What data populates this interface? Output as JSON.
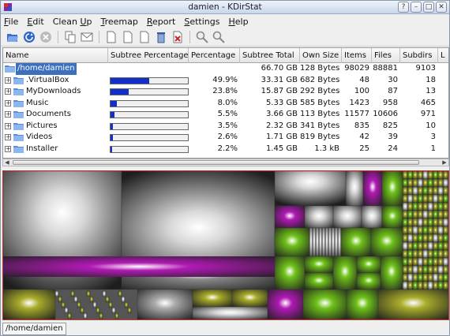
{
  "window": {
    "title": "damien - KDirStat"
  },
  "menu": [
    {
      "id": "file",
      "pre": "",
      "u": "F",
      "post": "ile"
    },
    {
      "id": "edit",
      "pre": "",
      "u": "E",
      "post": "dit"
    },
    {
      "id": "cleanup",
      "pre": "Clean ",
      "u": "U",
      "post": "p"
    },
    {
      "id": "treemap",
      "pre": "",
      "u": "T",
      "post": "reemap"
    },
    {
      "id": "report",
      "pre": "",
      "u": "R",
      "post": "eport"
    },
    {
      "id": "settings",
      "pre": "",
      "u": "S",
      "post": "ettings"
    },
    {
      "id": "help",
      "pre": "",
      "u": "H",
      "post": "elp"
    }
  ],
  "toolbar": [
    "open-folder-icon",
    "refresh-icon",
    "stop-icon",
    "copy-icon",
    "mail-icon",
    "page-icon",
    "page-icon",
    "page-icon",
    "trash-icon",
    "delete-icon",
    "zoom-in-icon",
    "zoom-out-icon"
  ],
  "columns": [
    "Name",
    "Subtree Percentage",
    "Percentage",
    "Subtree Total",
    "Own Size",
    "Items",
    "Files",
    "Subdirs",
    "L"
  ],
  "rows": [
    {
      "name": "/home/damien",
      "percent": "",
      "pct_fill": null,
      "subtree_total": "66.70 GB",
      "own_size": "128 Bytes",
      "items": "98029",
      "files": "88881",
      "subdirs": "9103",
      "root": true
    },
    {
      "name": ".VirtualBox",
      "percent": "49.9%",
      "pct_fill": 0.499,
      "subtree_total": "33.31 GB",
      "own_size": "682 Bytes",
      "items": "48",
      "files": "30",
      "subdirs": "18"
    },
    {
      "name": "MyDownloads",
      "percent": "23.8%",
      "pct_fill": 0.238,
      "subtree_total": "15.87 GB",
      "own_size": "292 Bytes",
      "items": "100",
      "files": "87",
      "subdirs": "13"
    },
    {
      "name": "Music",
      "percent": "8.0%",
      "pct_fill": 0.08,
      "subtree_total": "5.33 GB",
      "own_size": "585 Bytes",
      "items": "1423",
      "files": "958",
      "subdirs": "465"
    },
    {
      "name": "Documents",
      "percent": "5.5%",
      "pct_fill": 0.055,
      "subtree_total": "3.66 GB",
      "own_size": "113 Bytes",
      "items": "11577",
      "files": "10606",
      "subdirs": "971"
    },
    {
      "name": "Pictures",
      "percent": "3.5%",
      "pct_fill": 0.035,
      "subtree_total": "2.32 GB",
      "own_size": "341 Bytes",
      "items": "835",
      "files": "825",
      "subdirs": "10"
    },
    {
      "name": "Videos",
      "percent": "2.6%",
      "pct_fill": 0.026,
      "subtree_total": "1.71 GB",
      "own_size": "819 Bytes",
      "items": "42",
      "files": "39",
      "subdirs": "3"
    },
    {
      "name": "Installer",
      "percent": "2.2%",
      "pct_fill": 0.022,
      "subtree_total": "1.45 GB",
      "own_size": "1.3 kB",
      "items": "25",
      "files": "24",
      "subdirs": "1"
    }
  ],
  "colors": {
    "selection": "#3d6fbf",
    "bar": "#1230c8",
    "treemap_border": "#c43a2d",
    "magenta": "#b01ab4",
    "green": "#6fc21a",
    "olive": "#a8ac2a",
    "grey": "#d8d8d8"
  },
  "status": {
    "path": "/home/damien"
  }
}
